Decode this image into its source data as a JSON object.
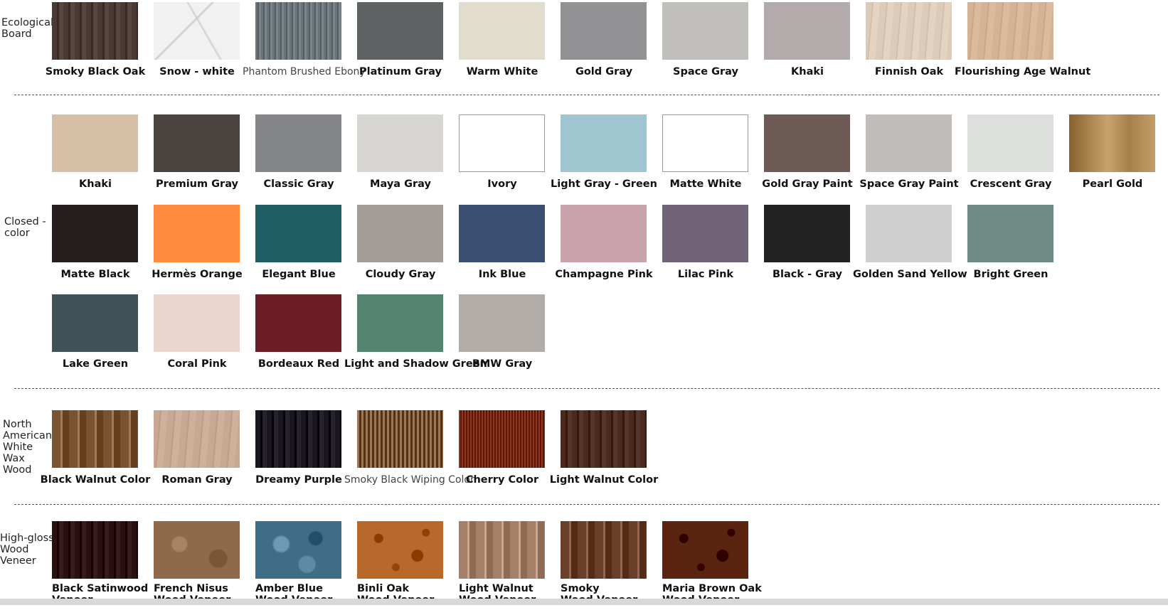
{
  "sections": [
    {
      "label": "Ecological\nBoard",
      "rows": [
        [
          {
            "name": "Smoky Black Oak",
            "color": "#4a3a33",
            "fx": "wood-dark"
          },
          {
            "name": "Snow - white",
            "color": "#f1f1f1",
            "fx": "marble"
          },
          {
            "name": "Phantom Brushed Ebony",
            "color": "#6a7478",
            "fx": "brushed",
            "light": true
          },
          {
            "name": "Platinum Gray",
            "color": "#5e6262"
          },
          {
            "name": "Warm White",
            "color": "#e2dccd"
          },
          {
            "name": "Gold Gray",
            "color": "#929295"
          },
          {
            "name": "Space Gray",
            "color": "#c1bfbb"
          },
          {
            "name": "Khaki",
            "color": "#b3aaab"
          },
          {
            "name": "Finnish Oak",
            "color": "#dccbb8",
            "fx": "wood-light"
          },
          {
            "name": "Flourishing Age Walnut",
            "color": "#d3b295",
            "fx": "wood-light"
          }
        ]
      ]
    },
    {
      "label": "Closed -\ncolor",
      "rows": [
        [
          {
            "name": "Khaki",
            "color": "#d6bfa4"
          },
          {
            "name": "Premium Gray",
            "color": "#4b4340"
          },
          {
            "name": "Classic Gray",
            "color": "#84868a"
          },
          {
            "name": "Maya Gray",
            "color": "#d8d6d2"
          },
          {
            "name": "Ivory",
            "color": "#ffffff",
            "bordered": true
          },
          {
            "name": "Light Gray - Green",
            "color": "#9fc5d0"
          },
          {
            "name": "Matte White",
            "color": "#ffffff",
            "bordered": true
          },
          {
            "name": "Gold Gray Paint",
            "color": "#6d5a54"
          },
          {
            "name": "Space Gray Paint",
            "color": "#c1bdba"
          },
          {
            "name": "Crescent Gray",
            "color": "#dcdfdb"
          },
          {
            "name": "Pearl Gold",
            "color": "#b08a55",
            "fx": "gold"
          }
        ],
        [
          {
            "name": "Matte Black",
            "color": "#241e1f"
          },
          {
            "name": "Hermès Orange",
            "color": "#fd8a3d"
          },
          {
            "name": "Elegant Blue",
            "color": "#1e5d63"
          },
          {
            "name": "Cloudy Gray",
            "color": "#a39d98"
          },
          {
            "name": "Ink Blue",
            "color": "#3b4f73"
          },
          {
            "name": "Champagne Pink",
            "color": "#c9a3ab"
          },
          {
            "name": "Lilac Pink",
            "color": "#706277"
          },
          {
            "name": "Black - Gray",
            "color": "#222222"
          },
          {
            "name": "Golden Sand Yellow",
            "color": "#cfcfcf"
          },
          {
            "name": "Bright Green",
            "color": "#6f8a84"
          }
        ],
        [
          {
            "name": "Lake Green",
            "color": "#3f5257"
          },
          {
            "name": "Coral Pink",
            "color": "#ead6cf"
          },
          {
            "name": "Bordeaux Red",
            "color": "#6c1c24"
          },
          {
            "name": "Light and Shadow Green",
            "color": "#548370"
          },
          {
            "name": "BMW Gray",
            "color": "#b1aca7"
          }
        ]
      ]
    },
    {
      "label": "North\nAmerican\nWhite\nWax\nWood",
      "rows": [
        [
          {
            "name": "Black Walnut Color",
            "color": "#7a5431",
            "fx": "wood-stripe"
          },
          {
            "name": "Roman Gray",
            "color": "#c7a892",
            "fx": "wood-light"
          },
          {
            "name": "Dreamy Purple",
            "color": "#1b1720",
            "fx": "wood-dark"
          },
          {
            "name": "Smoky Black Wiping Color",
            "color": "#7d5a3a",
            "fx": "grooves",
            "light": true
          },
          {
            "name": "Cherry Color",
            "color": "#7a2b14",
            "fx": "grooves-fine"
          },
          {
            "name": "Light Walnut Color",
            "color": "#4a2a1f",
            "fx": "wood-dark"
          }
        ]
      ]
    },
    {
      "label": "High-gloss\nWood\nVeneer",
      "rows": [
        [
          {
            "name": "Black Satinwood\nVeneer",
            "color": "#2a1010",
            "fx": "wood-dark"
          },
          {
            "name": "French Nisus\nWood Veneer",
            "color": "#8e6a4a",
            "fx": "burl-soft"
          },
          {
            "name": "Amber Blue\nWood Veneer",
            "color": "#3f6d86",
            "fx": "burl-blue"
          },
          {
            "name": "Binli Oak\nWood Veneer",
            "color": "#b9682b",
            "fx": "burl"
          },
          {
            "name": "Light Walnut\nWood Veneer",
            "color": "#a58068",
            "fx": "wood-stripe"
          },
          {
            "name": "Smoky\nWood Veneer",
            "color": "#6a3f2a",
            "fx": "wood-stripe"
          },
          {
            "name": "Maria Brown Oak\nWood Veneer",
            "color": "#5b2410",
            "fx": "burl"
          }
        ]
      ]
    }
  ]
}
